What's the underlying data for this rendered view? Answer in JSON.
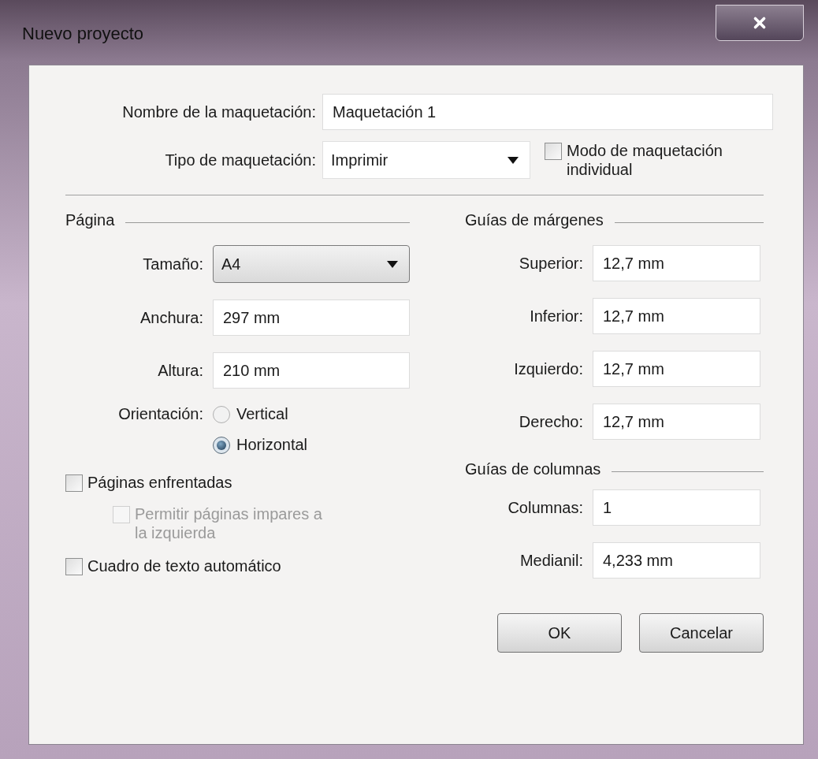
{
  "window": {
    "title": "Nuevo proyecto"
  },
  "layout_name": {
    "label": "Nombre de la maquetación:",
    "value": "Maquetación 1"
  },
  "layout_type": {
    "label": "Tipo de maquetación:",
    "value": "Imprimir"
  },
  "single_mode": {
    "label": "Modo de maquetación individual",
    "checked": false,
    "disabled": false
  },
  "page": {
    "title": "Página",
    "fields": [
      {
        "kind": "select",
        "label": "Tamaño:",
        "value": "A4"
      },
      {
        "kind": "text",
        "label": "Anchura:",
        "value": "297 mm"
      },
      {
        "kind": "text",
        "label": "Altura:",
        "value": "210 mm"
      }
    ],
    "orientation": {
      "label": "Orientación:",
      "options": [
        {
          "label": "Vertical",
          "selected": false
        },
        {
          "label": "Horizontal",
          "selected": true
        }
      ]
    },
    "options": [
      {
        "label": "Páginas enfrentadas",
        "checked": false,
        "disabled": false,
        "children": [
          {
            "label": "Permitir páginas impares a la izquierda",
            "checked": false,
            "disabled": true
          }
        ]
      },
      {
        "label": "Cuadro de texto automático",
        "checked": false,
        "disabled": false
      }
    ]
  },
  "margin_guides": {
    "title": "Guías de márgenes",
    "fields": [
      {
        "label": "Superior:",
        "value": "12,7 mm"
      },
      {
        "label": "Inferior:",
        "value": "12,7 mm"
      },
      {
        "label": "Izquierdo:",
        "value": "12,7 mm"
      },
      {
        "label": "Derecho:",
        "value": "12,7 mm"
      }
    ]
  },
  "column_guides": {
    "title": "Guías de columnas",
    "fields": [
      {
        "label": "Columnas:",
        "value": "1"
      },
      {
        "label": "Medianil:",
        "value": "4,233 mm"
      }
    ]
  },
  "buttons": [
    "OK",
    "Cancelar"
  ]
}
